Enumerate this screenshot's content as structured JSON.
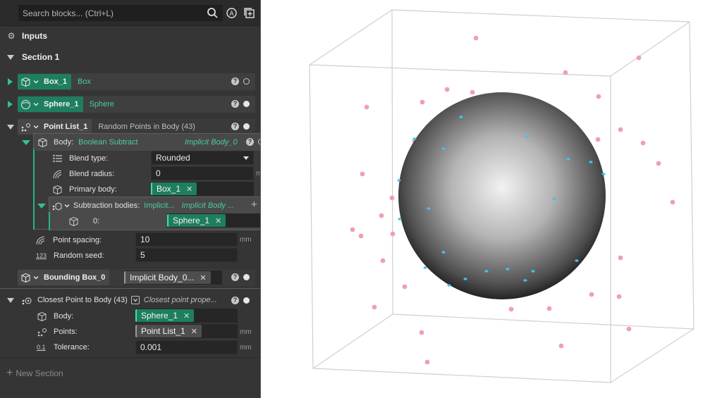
{
  "search": {
    "placeholder": "Search blocks... (Ctrl+L)"
  },
  "inputs": {
    "label": "Inputs"
  },
  "section": {
    "label": "Section 1"
  },
  "box": {
    "name": "Box_1",
    "type": "Box"
  },
  "sphere": {
    "name": "Sphere_1",
    "type": "Sphere"
  },
  "pointlist": {
    "name": "Point List_1",
    "desc": "Random Points in Body (43)"
  },
  "body": {
    "label": "Body:",
    "value": "Boolean Subtract",
    "implicit": "Implicit Body_0",
    "blend_type_label": "Blend type:",
    "blend_type_value": "Rounded",
    "blend_radius_label": "Blend radius:",
    "blend_radius_value": "0",
    "primary_label": "Primary body:",
    "primary_value": "Box_1",
    "subtraction_label": "Subtraction bodies:",
    "subtraction_value": "Implicit...",
    "subtraction_implicit": "Implicit Body ...",
    "index_label": "0:",
    "index_value": "Sphere_1"
  },
  "point_spacing": {
    "label": "Point spacing:",
    "value": "10"
  },
  "random_seed": {
    "label": "Random seed:",
    "value": "5"
  },
  "bounding": {
    "name": "Bounding Box_0",
    "value": "Implicit Body_0..."
  },
  "closest": {
    "name": "Closest Point to Body (43)",
    "props": "Closest point prope...",
    "body_label": "Body:",
    "body_value": "Sphere_1",
    "points_label": "Points:",
    "points_value": "Point List_1",
    "tolerance_label": "Tolerance:",
    "tolerance_value": "0.001"
  },
  "units": {
    "mm": "mm"
  },
  "new_section": {
    "label": "New Section"
  },
  "icon_text": {
    "random_seed": "123",
    "tolerance": "0.1"
  },
  "colors": {
    "accent": "#1e7e60",
    "point_pink": "#f0a0ac",
    "point_cyan": "#3cc8e6"
  },
  "viewport": {
    "pink_points": [
      [
        675,
        54
      ],
      [
        906,
        82
      ],
      [
        802,
        103
      ],
      [
        634,
        127
      ],
      [
        670,
        131
      ],
      [
        849,
        137
      ],
      [
        599,
        145
      ],
      [
        520,
        152
      ],
      [
        758,
        174
      ],
      [
        880,
        184
      ],
      [
        912,
        203
      ],
      [
        934,
        232
      ],
      [
        514,
        247
      ],
      [
        556,
        281
      ],
      [
        954,
        287
      ],
      [
        541,
        306
      ],
      [
        500,
        326
      ],
      [
        512,
        335
      ],
      [
        557,
        332
      ],
      [
        543,
        370
      ],
      [
        880,
        366
      ],
      [
        574,
        407
      ],
      [
        688,
        404
      ],
      [
        839,
        418
      ],
      [
        878,
        421
      ],
      [
        531,
        436
      ],
      [
        725,
        439
      ],
      [
        779,
        438
      ],
      [
        892,
        467
      ],
      [
        598,
        472
      ],
      [
        796,
        491
      ],
      [
        606,
        514
      ],
      [
        588,
        200
      ],
      [
        848,
        198
      ]
    ],
    "cyan_points": [
      [
        654,
        166
      ],
      [
        629,
        211
      ],
      [
        748,
        194
      ],
      [
        806,
        226
      ],
      [
        838,
        230
      ],
      [
        856,
        247
      ],
      [
        566,
        256
      ],
      [
        786,
        282
      ],
      [
        608,
        296
      ],
      [
        567,
        311
      ],
      [
        629,
        358
      ],
      [
        818,
        370
      ],
      [
        603,
        380
      ],
      [
        690,
        385
      ],
      [
        720,
        382
      ],
      [
        756,
        385
      ],
      [
        637,
        405
      ],
      [
        745,
        398
      ],
      [
        660,
        396
      ],
      [
        588,
        197
      ]
    ]
  }
}
